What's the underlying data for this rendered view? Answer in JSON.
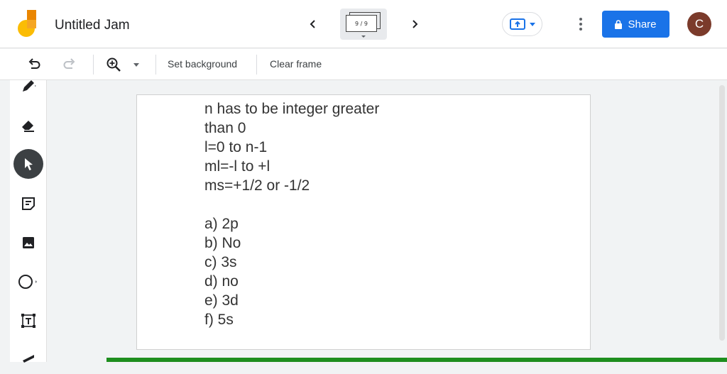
{
  "header": {
    "title": "Untitled Jam",
    "frame_indicator": "9 / 9",
    "share_label": "Share",
    "avatar_initial": "C"
  },
  "toolbar": {
    "set_background_label": "Set background",
    "clear_frame_label": "Clear frame"
  },
  "sidebar": {
    "tools": [
      "pen-icon",
      "eraser-icon",
      "select-icon",
      "sticky-note-icon",
      "image-icon",
      "circle-icon",
      "text-box-icon",
      "laser-icon"
    ],
    "active_tool": "select-icon"
  },
  "canvas": {
    "lines": [
      "n has to be integer greater",
      "than 0",
      "l=0 to n-1",
      "ml=-l to +l",
      "ms=+1/2 or -1/2",
      "",
      "a) 2p",
      "b) No",
      "c) 3s",
      "d) no",
      "e) 3d",
      "f) 5s"
    ]
  },
  "colors": {
    "accent": "#1a73e8",
    "avatar": "#7b3b2b",
    "progress": "#1e8e1e",
    "logo_yellow": "#fbbc04",
    "logo_orange": "#ea8600"
  }
}
